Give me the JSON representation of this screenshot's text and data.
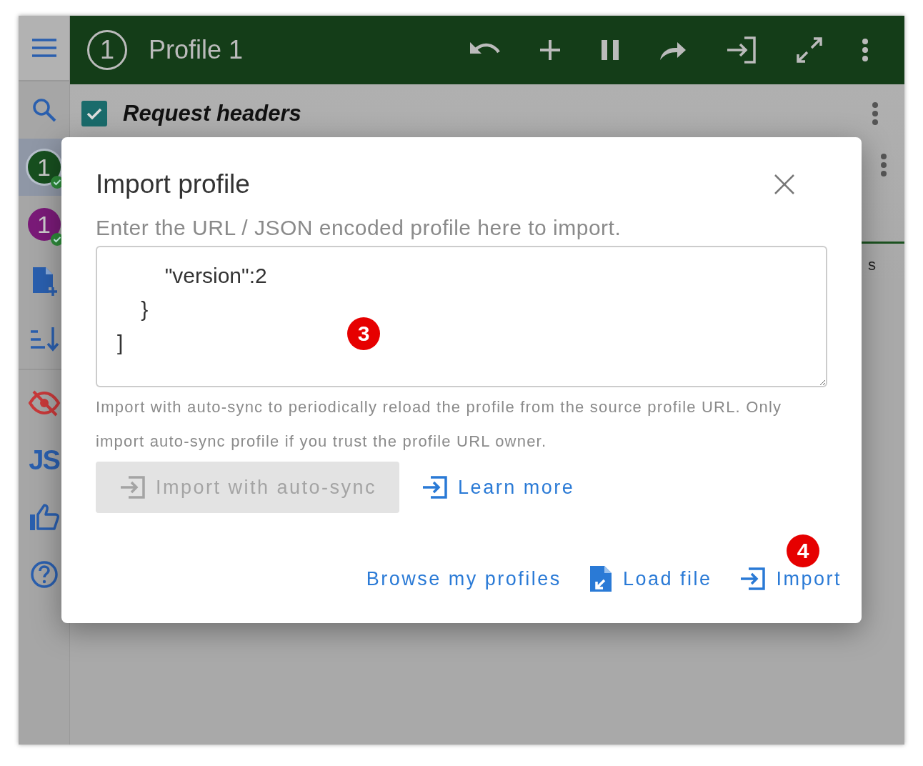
{
  "header": {
    "profile_number": "1",
    "title": "Profile 1"
  },
  "sidebar": {
    "avatars": [
      {
        "label": "1",
        "color": "#174f1f",
        "selected": true,
        "synced": true
      },
      {
        "label": "1",
        "color": "#7a1a78",
        "selected": false,
        "synced": true
      }
    ],
    "js_label": "JS"
  },
  "section": {
    "checked": true,
    "title": "Request headers",
    "partial_text": "s"
  },
  "dialog": {
    "title": "Import profile",
    "label": "Enter the URL / JSON encoded profile here to import.",
    "value": "        \"version\":2\n    }\n]",
    "help": "Import with auto-sync to periodically reload the profile from the source profile URL. Only import auto-sync profile if you trust the profile URL owner.",
    "autosync_button": {
      "label": "Import with auto-sync",
      "disabled": true
    },
    "learn_more": "Learn more",
    "actions": [
      {
        "kind": "browse",
        "label": "Browse my profiles"
      },
      {
        "kind": "load",
        "label": "Load file"
      },
      {
        "kind": "import",
        "label": "Import"
      }
    ]
  },
  "annotations": [
    "3",
    "4"
  ]
}
